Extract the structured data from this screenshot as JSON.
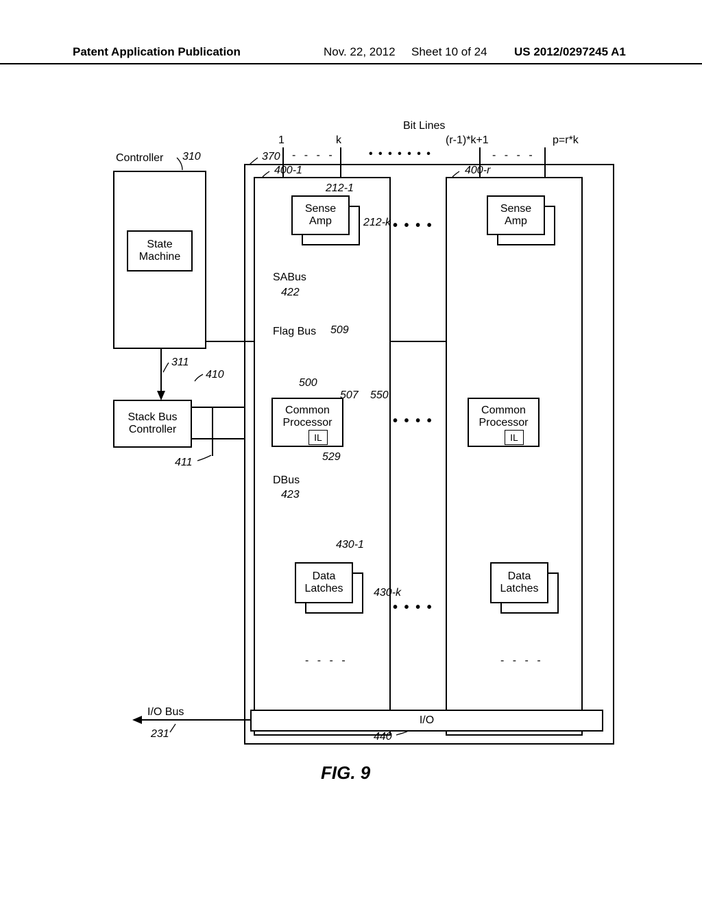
{
  "header": {
    "left": "Patent Application Publication",
    "date": "Nov. 22, 2012",
    "sheet": "Sheet 10 of 24",
    "pubno": "US 2012/0297245 A1"
  },
  "figure": {
    "label": "FIG. 9",
    "bit_lines_title": "Bit Lines",
    "bit_labels": {
      "one": "1",
      "k": "k",
      "r1": "(r-1)*k+1",
      "pk": "p=r*k"
    }
  },
  "blocks": {
    "controller": "Controller",
    "state_machine": "State\nMachine",
    "stack_bus_controller": "Stack Bus\nController",
    "sense_amp": "Sense\nAmp",
    "common_processor": "Common\nProcessor",
    "il": "IL",
    "data_latches": "Data\nLatches",
    "io": "I/O",
    "io_bus": "I/O Bus",
    "sabus": "SABus",
    "dbus": "DBus",
    "flag_bus": "Flag Bus"
  },
  "refs": {
    "r310": "310",
    "r370": "370",
    "r400_1": "400-1",
    "r400_r": "400-r",
    "r212_1": "212-1",
    "r212_k": "212-k",
    "r422": "422",
    "r509": "509",
    "r311": "311",
    "r410": "410",
    "r500": "500",
    "r507": "507",
    "r550": "550",
    "r411": "411",
    "r529": "529",
    "r423": "423",
    "r430_1": "430-1",
    "r430_k": "430-k",
    "r231": "231",
    "r440": "440"
  }
}
